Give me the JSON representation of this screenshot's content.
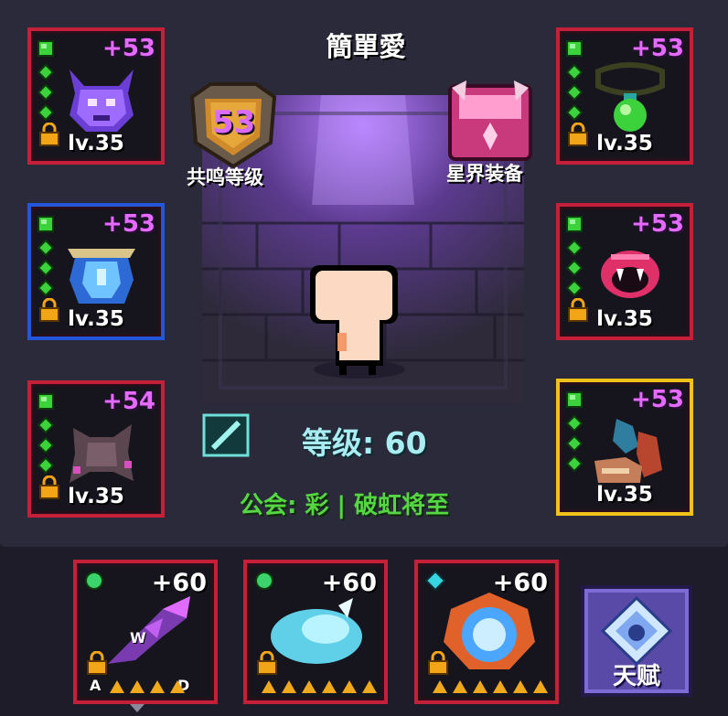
{
  "player": {
    "name": "簡單愛",
    "level_label": "等级: 60",
    "guild_label": "公会: 彩 | 破虹将至"
  },
  "resonance": {
    "value": "53",
    "label": "共鸣等级"
  },
  "astral": {
    "label": "星界装备"
  },
  "equipment_left": [
    {
      "plus": "+53",
      "level": "lv.35",
      "icon": "demon-helmet-icon",
      "frame": "red"
    },
    {
      "plus": "+53",
      "level": "lv.35",
      "icon": "crystal-armor-icon",
      "frame": "blue"
    },
    {
      "plus": "+54",
      "level": "lv.35",
      "icon": "shadow-wings-icon",
      "frame": "red"
    }
  ],
  "equipment_right": [
    {
      "plus": "+53",
      "level": "lv.35",
      "icon": "green-potion-amulet-icon",
      "frame": "red"
    },
    {
      "plus": "+53",
      "level": "lv.35",
      "icon": "fang-ring-icon",
      "frame": "red"
    },
    {
      "plus": "+53",
      "level": "lv.35",
      "icon": "dragon-boots-icon",
      "frame": "gold"
    }
  ],
  "weapons": [
    {
      "plus": "+60",
      "icon": "purple-gauntlet-icon",
      "gem_color": "#3bd36b",
      "stars": 5,
      "keys": {
        "up": "W",
        "left": "A",
        "right": "D"
      }
    },
    {
      "plus": "+60",
      "icon": "ice-dragon-icon",
      "gem_color": "#3bd36b",
      "stars": 5
    },
    {
      "plus": "+60",
      "icon": "blue-orb-shield-icon",
      "gem_color": "#35d6e0",
      "stars": 5
    }
  ],
  "talent": {
    "label": "天赋",
    "icon": "talent-crystal-icon"
  },
  "colors": {
    "plus": "#e56bff",
    "level_text": "#a9ecf2",
    "guild_text": "#56d643"
  }
}
